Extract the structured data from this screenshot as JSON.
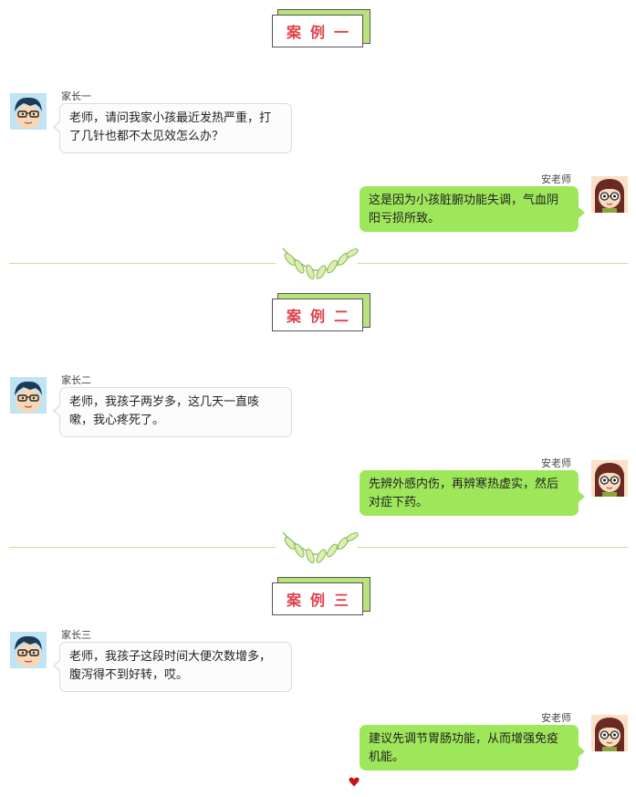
{
  "cases": [
    {
      "title": "案例一",
      "parent_name": "家长一",
      "parent_message": "老师，请问我家小孩最近发热严重，打了几针也都不太见效怎么办？",
      "teacher_name": "安老师",
      "teacher_message": "这是因为小孩脏腑功能失调，气血阴阳亏损所致。"
    },
    {
      "title": "案例二",
      "parent_name": "家长二",
      "parent_message": "老师，我孩子两岁多，这几天一直咳嗽，我心疼死了。",
      "teacher_name": "安老师",
      "teacher_message": "先辨外感内伤，再辨寒热虚实，然后对症下药。"
    },
    {
      "title": "案例三",
      "parent_name": "家长三",
      "parent_message": "老师，我孩子这段时间大便次数增多，腹泻得不到好转，哎。",
      "teacher_name": "安老师",
      "teacher_message": "建议先调节胃肠功能，从而增强免疫机能。"
    }
  ],
  "colors": {
    "title_red": "#e0404a",
    "title_green": "#b9e27a",
    "teacher_bubble": "#9ee65a",
    "parent_bubble": "#fcfcfc",
    "divider_line": "#c8e08a"
  },
  "icons": {
    "parent_avatar": "boy-avatar-icon",
    "teacher_avatar": "girl-avatar-icon",
    "divider": "leaf-branch-icon",
    "footer": "red-heart-icon"
  }
}
